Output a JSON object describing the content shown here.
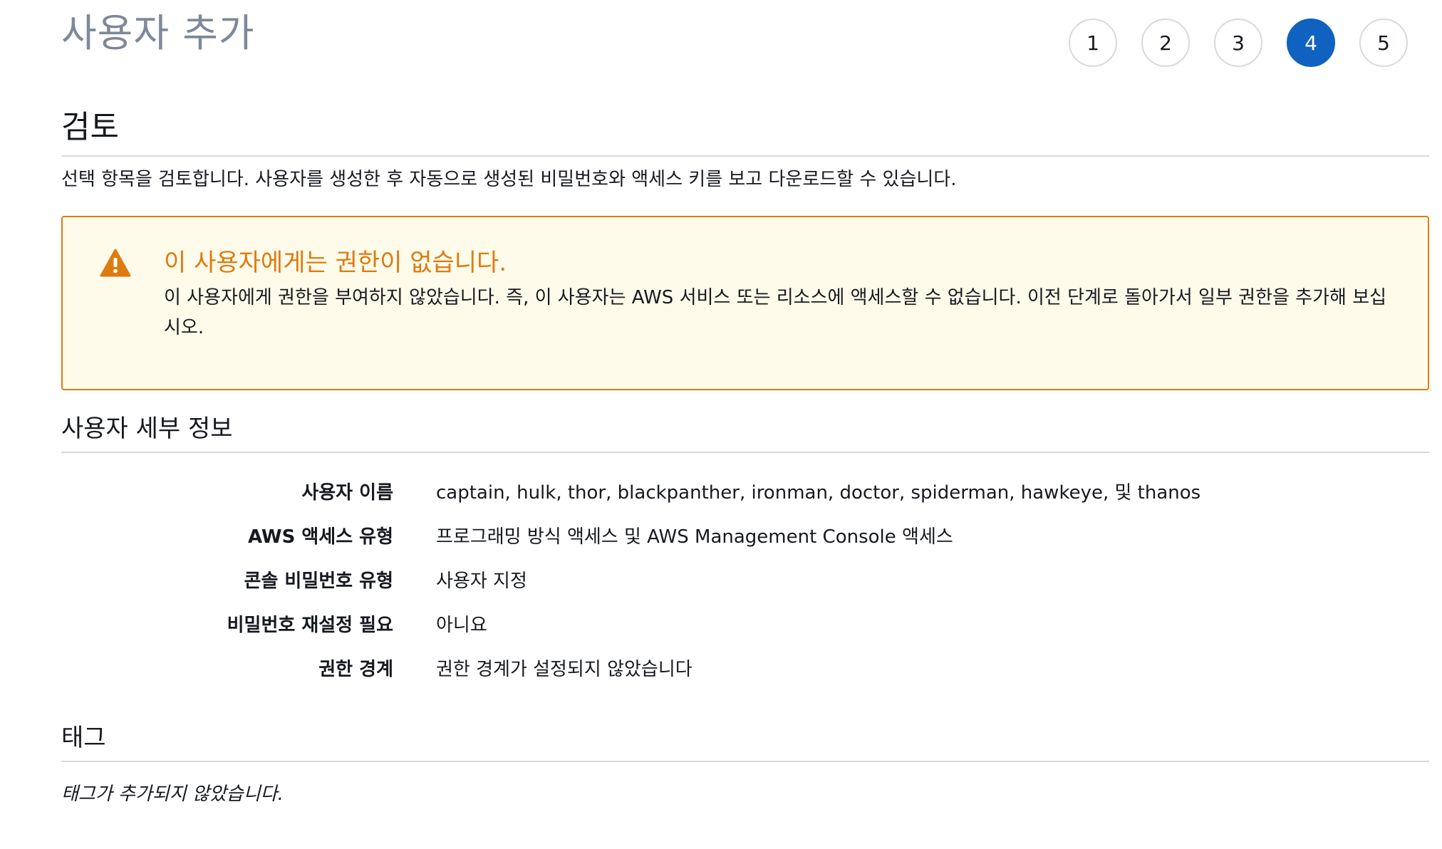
{
  "header": {
    "title": "사용자 추가"
  },
  "steps": {
    "items": [
      "1",
      "2",
      "3",
      "4",
      "5"
    ],
    "active": "4"
  },
  "review": {
    "heading": "검토",
    "description": "선택 항목을 검토합니다. 사용자를 생성한 후 자동으로 생성된 비밀번호와 액세스 키를 보고 다운로드할 수 있습니다."
  },
  "alert": {
    "icon": "warning-icon",
    "title": "이 사용자에게는 권한이 없습니다.",
    "body": "이 사용자에게 권한을 부여하지 않았습니다. 즉, 이 사용자는 AWS 서비스 또는 리소스에 액세스할 수 없습니다. 이전 단계로 돌아가서 일부 권한을 추가해 보십시오.",
    "border_color": "#e07b14",
    "background_color": "#fffbea",
    "title_color": "#df7a0f"
  },
  "details": {
    "heading": "사용자 세부 정보",
    "rows": [
      {
        "label": "사용자 이름",
        "value": "captain, hulk, thor, blackpanther, ironman, doctor, spiderman, hawkeye, 및 thanos"
      },
      {
        "label": "AWS 액세스 유형",
        "value": "프로그래밍 방식 액세스 및 AWS Management Console 액세스"
      },
      {
        "label": "콘솔 비밀번호 유형",
        "value": "사용자 지정"
      },
      {
        "label": "비밀번호 재설정 필요",
        "value": "아니요"
      },
      {
        "label": "권한 경계",
        "value": "권한 경계가 설정되지 않았습니다"
      }
    ]
  },
  "tags": {
    "heading": "태그",
    "empty_text": "태그가 추가되지 않았습니다."
  },
  "colors": {
    "active_step": "#0f62c0",
    "title_gray": "#7d8998"
  }
}
